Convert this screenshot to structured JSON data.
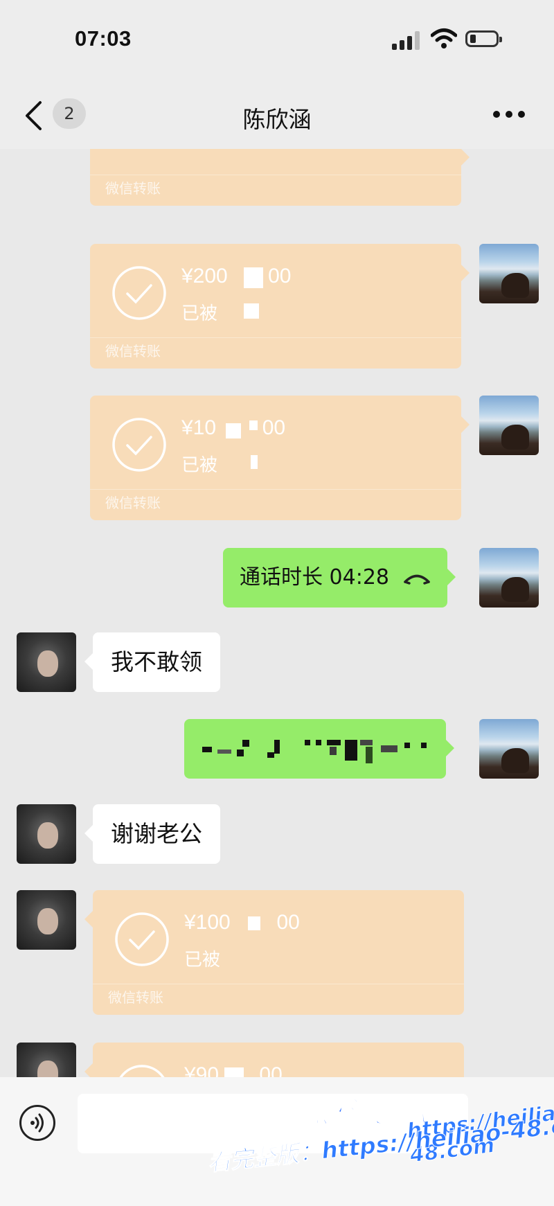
{
  "status_bar": {
    "time": "07:03"
  },
  "nav": {
    "unread_count": "2",
    "title": "陈欣涵"
  },
  "messages": {
    "transfer_1": {
      "amount": "",
      "status": "",
      "footer": "微信转账"
    },
    "transfer_2": {
      "amount": "¥200",
      "amount_tail": "00",
      "status": "已被",
      "footer": "微信转账"
    },
    "transfer_3": {
      "amount": "¥10",
      "amount_tail": "00",
      "status": "已被",
      "footer": "微信转账"
    },
    "call": {
      "text": "通话时长 04:28"
    },
    "reply_1": {
      "text": "我不敢领"
    },
    "reply_2": {
      "text": "谢谢老公"
    },
    "transfer_4": {
      "amount": "¥100",
      "amount_tail": "00",
      "status": "已被",
      "footer": "微信转账"
    },
    "transfer_5": {
      "amount": "¥90",
      "amount_tail": ".00"
    }
  },
  "watermark": {
    "brand": "黑料吃瓜网",
    "url": "https://heiliao-48.com",
    "line": "看完整版：https://heiliao-48.com"
  },
  "colors": {
    "transfer_card": "#f8dcb9",
    "green_bubble": "#95ec69",
    "watermark": "#2f7bff"
  }
}
